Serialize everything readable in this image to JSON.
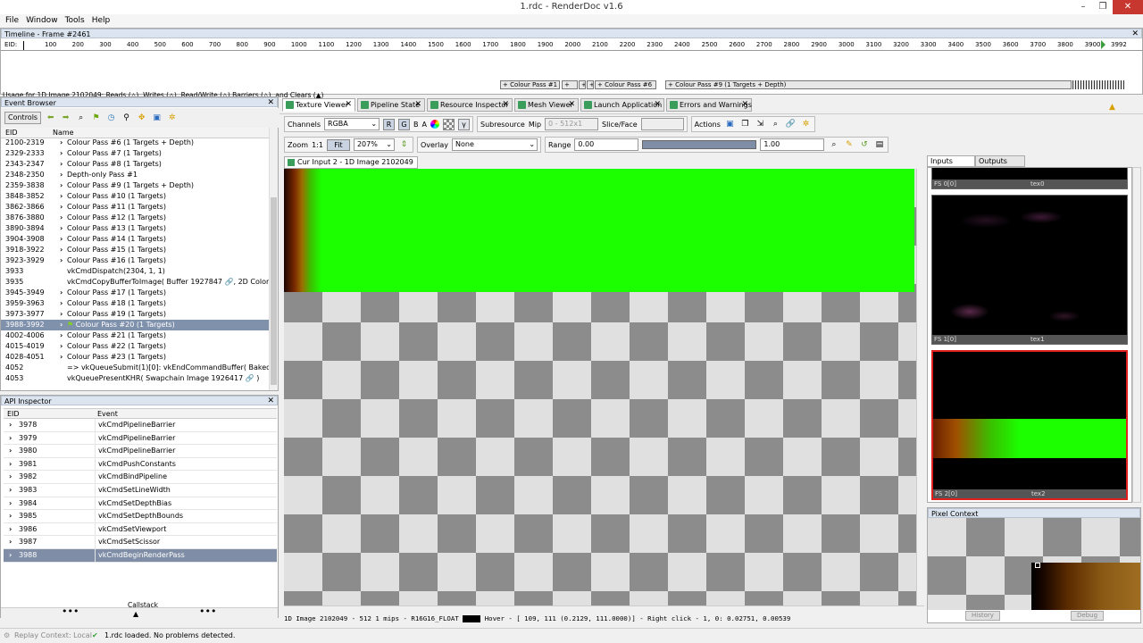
{
  "window": {
    "title": "1.rdc - RenderDoc v1.6",
    "minimize": "–",
    "maximize": "❐",
    "close": "✕"
  },
  "menu": [
    "File",
    "Window",
    "Tools",
    "Help"
  ],
  "timeline": {
    "title": "Timeline - Frame #2461",
    "eid_label": "EID:",
    "ticks": [
      "100",
      "200",
      "300",
      "400",
      "500",
      "600",
      "700",
      "800",
      "900",
      "1000",
      "1100",
      "1200",
      "1300",
      "1400",
      "1500",
      "1600",
      "1700",
      "1800",
      "1900",
      "2000",
      "2100",
      "2200",
      "2300",
      "2400",
      "2500",
      "2600",
      "2700",
      "2800",
      "2900",
      "3000",
      "3100",
      "3200",
      "3300",
      "3400",
      "3500",
      "3600",
      "3700",
      "3800",
      "3900"
    ],
    "current_eid": "3992",
    "passes": [
      "+ Colour Pass #1",
      "+",
      "+",
      "+",
      "+ Colour Pass #6",
      "+ Colour Pass #9 (1 Targets + Depth)"
    ],
    "usage": "Usage for 1D Image 2102049: Reads (△), Writes (△), Read/Write (△) Barriers (△), and Clears (▲)"
  },
  "event_browser": {
    "title": "Event Browser",
    "controls_label": "Controls",
    "col_eid": "EID",
    "col_name": "Name",
    "rows": [
      {
        "eid": "2100-2319",
        "name": "Colour Pass #6 (1 Targets + Depth)",
        "chev": true
      },
      {
        "eid": "2329-2333",
        "name": "Colour Pass #7 (1 Targets)",
        "chev": true
      },
      {
        "eid": "2343-2347",
        "name": "Colour Pass #8 (1 Targets)",
        "chev": true
      },
      {
        "eid": "2348-2350",
        "name": "Depth-only Pass #1",
        "chev": true
      },
      {
        "eid": "2359-3838",
        "name": "Colour Pass #9 (1 Targets + Depth)",
        "chev": true
      },
      {
        "eid": "3848-3852",
        "name": "Colour Pass #10 (1 Targets)",
        "chev": true
      },
      {
        "eid": "3862-3866",
        "name": "Colour Pass #11 (1 Targets)",
        "chev": true
      },
      {
        "eid": "3876-3880",
        "name": "Colour Pass #12 (1 Targets)",
        "chev": true
      },
      {
        "eid": "3890-3894",
        "name": "Colour Pass #13 (1 Targets)",
        "chev": true
      },
      {
        "eid": "3904-3908",
        "name": "Colour Pass #14 (1 Targets)",
        "chev": true
      },
      {
        "eid": "3918-3922",
        "name": "Colour Pass #15 (1 Targets)",
        "chev": true
      },
      {
        "eid": "3923-3929",
        "name": "Colour Pass #16 (1 Targets)",
        "chev": true
      },
      {
        "eid": "3933",
        "name": "vkCmdDispatch(2304, 1, 1)",
        "chev": false
      },
      {
        "eid": "3935",
        "name": "vkCmdCopyBufferToImage( Buffer 1927847 🔗, 2D Color Att",
        "chev": false
      },
      {
        "eid": "3945-3949",
        "name": "Colour Pass #17 (1 Targets)",
        "chev": true
      },
      {
        "eid": "3959-3963",
        "name": "Colour Pass #18 (1 Targets)",
        "chev": true
      },
      {
        "eid": "3973-3977",
        "name": "Colour Pass #19 (1 Targets)",
        "chev": true
      },
      {
        "eid": "3988-3992",
        "name": "Colour Pass #20 (1 Targets)",
        "chev": true,
        "sel": true
      },
      {
        "eid": "4002-4006",
        "name": "Colour Pass #21 (1 Targets)",
        "chev": true
      },
      {
        "eid": "4015-4019",
        "name": "Colour Pass #22 (1 Targets)",
        "chev": true
      },
      {
        "eid": "4028-4051",
        "name": "Colour Pass #23 (1 Targets)",
        "chev": true
      },
      {
        "eid": "4052",
        "name": "=> vkQueueSubmit(1)[0]: vkEndCommandBuffer( Baked Comm",
        "chev": false
      },
      {
        "eid": "4053",
        "name": "vkQueuePresentKHR( Swapchain Image 1926417 🔗 )",
        "chev": false
      }
    ]
  },
  "api_inspector": {
    "title": "API Inspector",
    "col_eid": "EID",
    "col_event": "Event",
    "rows": [
      {
        "eid": "3978",
        "ev": "vkCmdPipelineBarrier"
      },
      {
        "eid": "3979",
        "ev": "vkCmdPipelineBarrier"
      },
      {
        "eid": "3980",
        "ev": "vkCmdPipelineBarrier"
      },
      {
        "eid": "3981",
        "ev": "vkCmdPushConstants"
      },
      {
        "eid": "3982",
        "ev": "vkCmdBindPipeline"
      },
      {
        "eid": "3983",
        "ev": "vkCmdSetLineWidth"
      },
      {
        "eid": "3984",
        "ev": "vkCmdSetDepthBias"
      },
      {
        "eid": "3985",
        "ev": "vkCmdSetDepthBounds"
      },
      {
        "eid": "3986",
        "ev": "vkCmdSetViewport"
      },
      {
        "eid": "3987",
        "ev": "vkCmdSetScissor"
      },
      {
        "eid": "3988",
        "ev": "vkCmdBeginRenderPass",
        "sel": true
      }
    ],
    "callstack_label": "Callstack"
  },
  "tabs": [
    "Texture Viewer",
    "Pipeline State",
    "Resource Inspector",
    "Mesh Viewer",
    "Launch Application",
    "Errors and Warnings"
  ],
  "texture_viewer": {
    "channels_label": "Channels",
    "channels_value": "RGBA",
    "ch_r": "R",
    "ch_g": "G",
    "ch_b": "B",
    "ch_a": "A",
    "subresource_label": "Subresource",
    "mip_label": "Mip",
    "mip_value": "0 - 512x1",
    "slice_label": "Slice/Face",
    "actions_label": "Actions",
    "zoom_label": "Zoom",
    "zoom_1to1": "1:1",
    "fit_label": "Fit",
    "zoom_value": "207%",
    "overlay_label": "Overlay",
    "overlay_value": "None",
    "range_label": "Range",
    "range_min": "0.00",
    "range_max": "1.00",
    "tex_tab": "Cur Input 2 - 1D Image 2102049",
    "status": "1D Image 2102049 - 512 1 mips - R16G16_FLOAT",
    "status_hover": "Hover - [ 109,  111 (0.2129, 111.0000)] - Right click -    1,    0: 0.02751, 0.00539"
  },
  "inputs_panel": {
    "tab_inputs": "Inputs",
    "tab_outputs": "Outputs",
    "thumbs": [
      {
        "slot": "FS 0[0]",
        "name": "tex0"
      },
      {
        "slot": "FS 1[0]",
        "name": "tex1"
      },
      {
        "slot": "FS 2[0]",
        "name": "tex2"
      }
    ]
  },
  "pixel_context": {
    "title": "Pixel Context",
    "history": "History",
    "debug": "Debug"
  },
  "statusbar": {
    "replay": "Replay Context: Local",
    "message": "1.rdc loaded. No problems detected."
  },
  "colors": {
    "accent_select": "#8091ac",
    "texture_green": "#1bff00",
    "close_red": "#c7372f",
    "thumb_highlight": "#e0201c"
  }
}
